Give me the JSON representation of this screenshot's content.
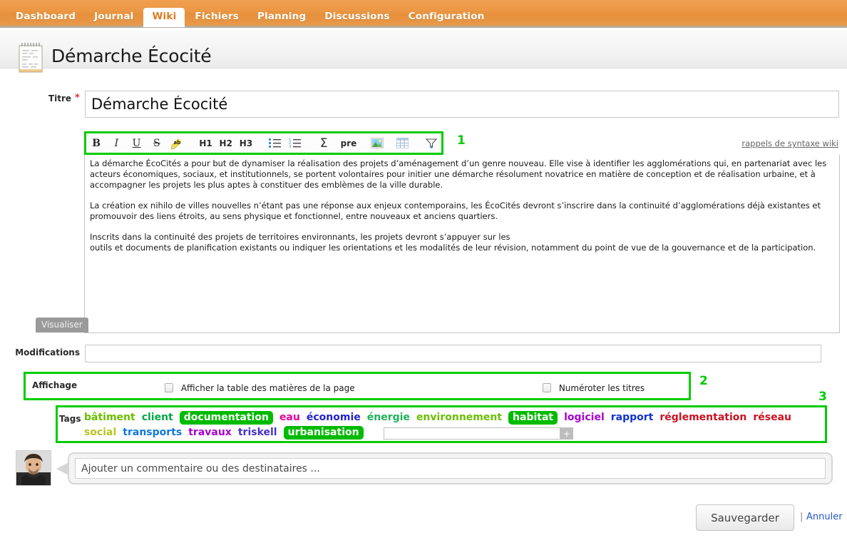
{
  "nav": {
    "items": [
      {
        "label": "Dashboard",
        "active": false
      },
      {
        "label": "Journal",
        "active": false
      },
      {
        "label": "Wiki",
        "active": true
      },
      {
        "label": "Fichiers",
        "active": false
      },
      {
        "label": "Planning",
        "active": false
      },
      {
        "label": "Discussions",
        "active": false
      },
      {
        "label": "Configuration",
        "active": false
      }
    ]
  },
  "header": {
    "title": "Démarche Écocité",
    "icon": "notepad-icon"
  },
  "form": {
    "titre_label": "Titre",
    "required_marker": "*",
    "titre_value": "Démarche Écocité",
    "modifications_label": "Modifications",
    "modifications_value": "",
    "preview_button": "Visualiser",
    "syntax_link": "rappels de syntaxe wiki"
  },
  "toolbar": {
    "buttons": [
      {
        "name": "bold-icon",
        "label": "B"
      },
      {
        "name": "italic-icon",
        "label": "I"
      },
      {
        "name": "underline-icon",
        "label": "U"
      },
      {
        "name": "strikethrough-icon",
        "label": "S"
      },
      {
        "name": "highlight-icon",
        "label": "ab"
      },
      {
        "name": "heading-1-button",
        "label": "H1"
      },
      {
        "name": "heading-2-button",
        "label": "H2"
      },
      {
        "name": "heading-3-button",
        "label": "H3"
      },
      {
        "name": "bullet-list-icon",
        "label": ""
      },
      {
        "name": "numbered-list-icon",
        "label": ""
      },
      {
        "name": "sigma-icon",
        "label": "Σ"
      },
      {
        "name": "preformatted-button",
        "label": "pre"
      },
      {
        "name": "image-icon",
        "label": ""
      },
      {
        "name": "table-icon",
        "label": ""
      },
      {
        "name": "filter-icon",
        "label": ""
      }
    ]
  },
  "editor": {
    "paragraphs": [
      "La démarche ÉcoCités a pour but de dynamiser la réalisation des projets d’aménagement d’un genre nouveau. Elle vise à identifier les agglomérations qui, en partenariat avec les acteurs économiques, sociaux, et institutionnels, se portent volontaires pour initier une démarche résolument novatrice en matière de conception et de réalisation urbaine, et à accompagner les projets les plus aptes à constituer des emblèmes de la ville durable.",
      "La création ex nihilo de villes nouvelles n’étant pas une réponse aux enjeux contemporains, les ÉcoCités devront s’inscrire dans la continuité d’agglomérations déjà existantes et promouvoir des liens étroits, au sens physique et fonctionnel, entre nouveaux et anciens quartiers.",
      "Inscrits dans la continuité des projets de territoires environnants, les projets devront s’appuyer sur les\noutils et documents de planification existants ou indiquer les orientations et les modalités de leur révision, notamment du point de vue de la gouvernance et de la participation."
    ]
  },
  "affichage": {
    "label": "Affichage",
    "options": [
      {
        "label": "Afficher la table des matières de la page",
        "checked": false
      },
      {
        "label": "Numéroter les titres",
        "checked": false
      }
    ]
  },
  "tags": {
    "label": "Tags",
    "items": [
      {
        "label": "bâtiment",
        "color": "#6abf00",
        "selected": false
      },
      {
        "label": "client",
        "color": "#00a844",
        "selected": false
      },
      {
        "label": "documentation",
        "color": "#ffffff",
        "selected": true
      },
      {
        "label": "eau",
        "color": "#e0009a",
        "selected": false
      },
      {
        "label": "économie",
        "color": "#2222cc",
        "selected": false
      },
      {
        "label": "énergie",
        "color": "#1eb35a",
        "selected": false
      },
      {
        "label": "environnement",
        "color": "#6abf00",
        "selected": false
      },
      {
        "label": "habitat",
        "color": "#ffffff",
        "selected": true
      },
      {
        "label": "logiciel",
        "color": "#a800d0",
        "selected": false
      },
      {
        "label": "rapport",
        "color": "#1133cc",
        "selected": false
      },
      {
        "label": "réglementation",
        "color": "#cc1122",
        "selected": false
      },
      {
        "label": "réseau",
        "color": "#cc1122",
        "selected": false
      },
      {
        "label": "social",
        "color": "#b8c522",
        "selected": false
      },
      {
        "label": "transports",
        "color": "#1177dd",
        "selected": false
      },
      {
        "label": "travaux",
        "color": "#a800d0",
        "selected": false
      },
      {
        "label": "triskell",
        "color": "#4433cc",
        "selected": false
      },
      {
        "label": "urbanisation",
        "color": "#ffffff",
        "selected": true
      }
    ],
    "new_tag_value": "",
    "add_button": "+"
  },
  "comment": {
    "placeholder": "Ajouter un commentaire ou des destinataires ...",
    "value": ""
  },
  "footer": {
    "save_label": "Sauvegarder",
    "separator": "|",
    "cancel_label": "Annuler"
  },
  "annotations": {
    "one": "1",
    "two": "2",
    "three": "3",
    "color": "#00cc00"
  }
}
